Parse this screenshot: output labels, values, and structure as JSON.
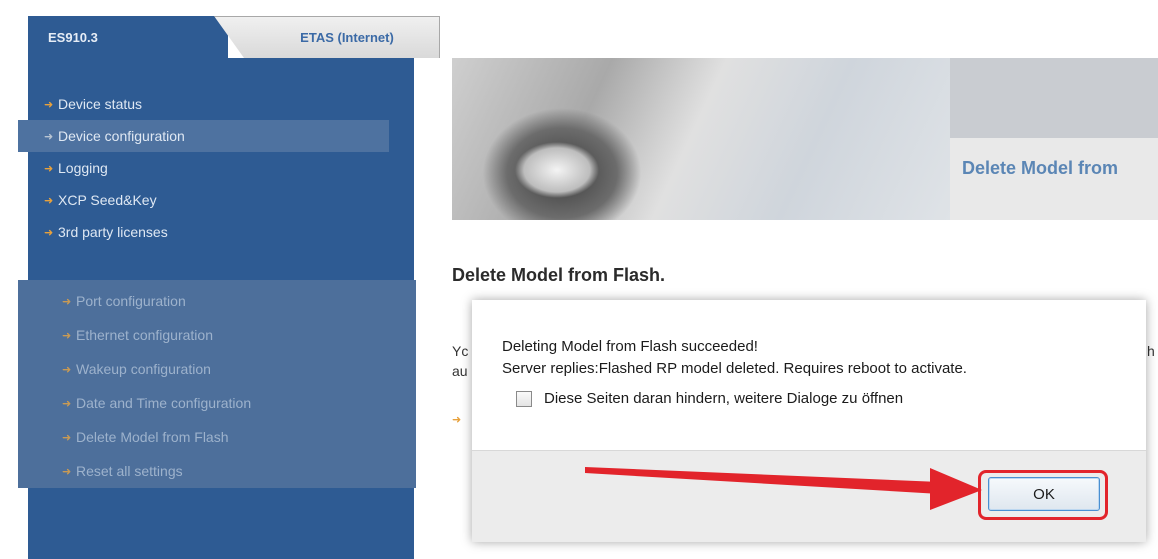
{
  "tabs": [
    {
      "label": "ES910.3",
      "active": true
    },
    {
      "label": "ETAS (Internet)",
      "active": false
    }
  ],
  "sidebar": {
    "items": [
      {
        "label": "Device status"
      },
      {
        "label": "Device configuration",
        "active": true
      },
      {
        "label": "Logging"
      },
      {
        "label": "XCP Seed&Key"
      },
      {
        "label": "3rd party licenses"
      }
    ],
    "sub_items": [
      {
        "label": "Port configuration"
      },
      {
        "label": "Ethernet configuration"
      },
      {
        "label": "Wakeup configuration"
      },
      {
        "label": "Date and Time configuration"
      },
      {
        "label": "Delete Model from Flash"
      },
      {
        "label": "Reset all settings"
      }
    ]
  },
  "banner": {
    "title": "Delete Model from"
  },
  "page": {
    "heading": "Delete Model from Flash.",
    "para_fragments": [
      "Yc",
      "au",
      "h"
    ]
  },
  "dialog": {
    "message_line1": "Deleting Model from Flash succeeded!",
    "message_line2": "Server replies:Flashed RP model deleted. Requires reboot to activate.",
    "checkbox_label": "Diese Seiten daran hindern, weitere Dialoge zu öffnen",
    "checkbox_checked": false,
    "ok_label": "OK"
  },
  "annotation": {
    "color": "#e2242b"
  },
  "icons": {
    "nav_arrow": "arrow-right-icon",
    "checkbox": "checkbox-icon"
  },
  "colors": {
    "sidebar": "#2e5b93",
    "accent_orange": "#e7a13c",
    "title_blue": "#5b86b5"
  }
}
